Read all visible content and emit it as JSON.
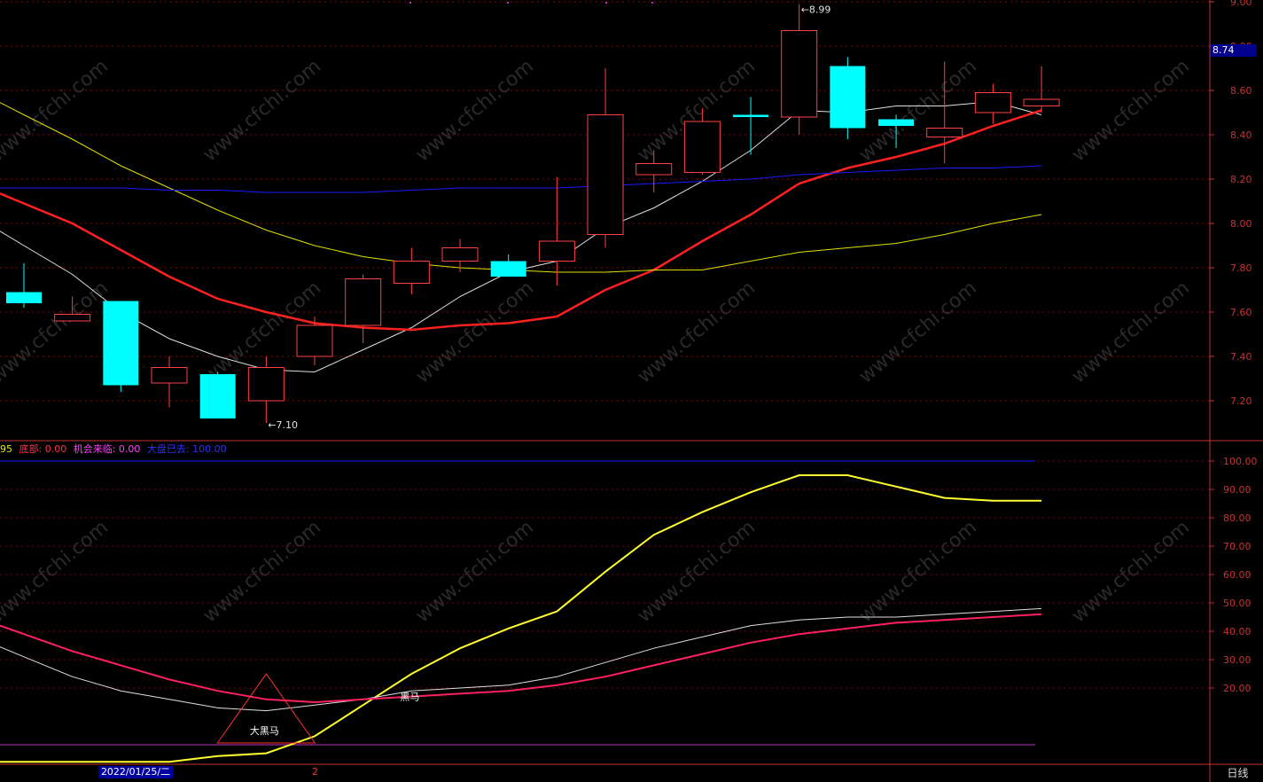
{
  "current_price_tag": "8.74",
  "period_label": "日线",
  "date_cursor": "2022/01/25/二",
  "date_cursor_2": "2",
  "indicator_header": [
    {
      "text": "95",
      "color": "#e6e600"
    },
    {
      "text": "底部: 0.00",
      "color": "#ff3050"
    },
    {
      "text": "机会来临: 0.00",
      "color": "#ff40ff"
    },
    {
      "text": "大盘已去: 100.00",
      "color": "#3030ff"
    }
  ],
  "watermark_text": "www.cfchi.com",
  "colors": {
    "up_candle": "#ff4040",
    "down_candle": "#00ffff",
    "ma_white": "#e0e0e0",
    "ma_red": "#ff2020",
    "ma_yellow": "#e0e000",
    "ma_blue": "#1a1aff",
    "grid": "#8b0000",
    "axis": "#c83232"
  },
  "chart_data": [
    {
      "type": "candlestick",
      "title": "",
      "ylim": [
        7.05,
        9.0
      ],
      "y_ticks": [
        "9.00",
        "8.80",
        "8.60",
        "8.40",
        "8.20",
        "8.00",
        "7.80",
        "7.60",
        "7.40",
        "7.20"
      ],
      "annotations": [
        {
          "text": "8.99",
          "candle_index": 16
        },
        {
          "text": "7.10",
          "candle_index": 5
        }
      ],
      "candles": [
        {
          "open": 7.64,
          "close": 7.69,
          "high": 7.82,
          "low": 7.62,
          "dir": "down"
        },
        {
          "open": 7.59,
          "close": 7.56,
          "high": 7.67,
          "low": 7.56,
          "dir": "up"
        },
        {
          "open": 7.65,
          "close": 7.27,
          "high": 7.65,
          "low": 7.24,
          "dir": "down"
        },
        {
          "open": 7.28,
          "close": 7.35,
          "high": 7.4,
          "low": 7.17,
          "dir": "up"
        },
        {
          "open": 7.32,
          "close": 7.12,
          "high": 7.33,
          "low": 7.12,
          "dir": "down"
        },
        {
          "open": 7.2,
          "close": 7.35,
          "high": 7.4,
          "low": 7.1,
          "dir": "up"
        },
        {
          "open": 7.4,
          "close": 7.54,
          "high": 7.58,
          "low": 7.36,
          "dir": "up"
        },
        {
          "open": 7.54,
          "close": 7.75,
          "high": 7.77,
          "low": 7.46,
          "dir": "up"
        },
        {
          "open": 7.73,
          "close": 7.83,
          "high": 7.89,
          "low": 7.68,
          "dir": "up"
        },
        {
          "open": 7.83,
          "close": 7.89,
          "high": 7.93,
          "low": 7.78,
          "dir": "up"
        },
        {
          "open": 7.83,
          "close": 7.76,
          "high": 7.86,
          "low": 7.76,
          "dir": "down"
        },
        {
          "open": 7.83,
          "close": 7.92,
          "high": 8.21,
          "low": 7.72,
          "dir": "up"
        },
        {
          "open": 7.95,
          "close": 8.49,
          "high": 8.7,
          "low": 7.89,
          "dir": "up"
        },
        {
          "open": 8.22,
          "close": 8.27,
          "high": 8.33,
          "low": 8.14,
          "dir": "up"
        },
        {
          "open": 8.23,
          "close": 8.46,
          "high": 8.52,
          "low": 8.22,
          "dir": "up"
        },
        {
          "open": 8.49,
          "close": 8.48,
          "high": 8.57,
          "low": 8.31,
          "dir": "down"
        },
        {
          "open": 8.48,
          "close": 8.87,
          "high": 8.99,
          "low": 8.4,
          "dir": "up"
        },
        {
          "open": 8.71,
          "close": 8.43,
          "high": 8.75,
          "low": 8.38,
          "dir": "down"
        },
        {
          "open": 8.47,
          "close": 8.44,
          "high": 8.49,
          "low": 8.34,
          "dir": "down"
        },
        {
          "open": 8.39,
          "close": 8.43,
          "high": 8.73,
          "low": 8.27,
          "dir": "up"
        },
        {
          "open": 8.5,
          "close": 8.59,
          "high": 8.63,
          "low": 8.45,
          "dir": "up"
        },
        {
          "open": 8.53,
          "close": 8.56,
          "high": 8.71,
          "low": 8.5,
          "dir": "up"
        }
      ],
      "series": [
        {
          "color": "#e0e0e0",
          "values": [
            7.9,
            7.77,
            7.6,
            7.48,
            7.4,
            7.34,
            7.33,
            7.43,
            7.53,
            7.67,
            7.78,
            7.83,
            7.98,
            8.07,
            8.19,
            8.33,
            8.51,
            8.5,
            8.53,
            8.53,
            8.55,
            8.49
          ]
        },
        {
          "color": "#ff2020",
          "values": [
            8.09,
            8.0,
            7.88,
            7.76,
            7.66,
            7.6,
            7.55,
            7.53,
            7.52,
            7.54,
            7.55,
            7.58,
            7.7,
            7.79,
            7.92,
            8.04,
            8.18,
            8.25,
            8.3,
            8.36,
            8.44,
            8.51
          ]
        },
        {
          "color": "#e0e000",
          "values": [
            8.49,
            8.38,
            8.26,
            8.16,
            8.06,
            7.97,
            7.9,
            7.85,
            7.82,
            7.8,
            7.79,
            7.78,
            7.78,
            7.79,
            7.79,
            7.83,
            7.87,
            7.89,
            7.91,
            7.95,
            8.0,
            8.04
          ]
        },
        {
          "color": "#1a1aff",
          "values": [
            8.16,
            8.16,
            8.16,
            8.15,
            8.15,
            8.14,
            8.14,
            8.14,
            8.15,
            8.16,
            8.16,
            8.16,
            8.17,
            8.18,
            8.19,
            8.2,
            8.22,
            8.23,
            8.24,
            8.25,
            8.25,
            8.26
          ]
        }
      ]
    },
    {
      "type": "line",
      "title": "",
      "ylim": [
        0,
        105
      ],
      "y_ticks": [
        "100.00",
        "90.00",
        "80.00",
        "70.00",
        "60.00",
        "50.00",
        "40.00",
        "30.00",
        "20.00"
      ],
      "reference_lines": [
        {
          "value": 100,
          "color": "#1a1aff"
        },
        {
          "value": 0,
          "color": "#c030c0"
        }
      ],
      "labels": [
        {
          "text": "大黑马",
          "x_index": 5,
          "y": 5
        },
        {
          "text": "黑马",
          "x_index": 8,
          "y": 17
        }
      ],
      "series": [
        {
          "color": "#ffff30",
          "values": [
            -6,
            -6,
            -6,
            -6,
            -4,
            -3,
            3,
            14,
            25,
            34,
            41,
            47,
            61,
            74,
            82,
            89,
            95,
            95,
            91,
            87,
            86,
            86
          ]
        },
        {
          "color": "#e0e0e0",
          "values": [
            31,
            24,
            19,
            16,
            13,
            12,
            14,
            16,
            19,
            20,
            21,
            24,
            29,
            34,
            38,
            42,
            44,
            45,
            45,
            46,
            47,
            48
          ]
        },
        {
          "color": "#ff2060",
          "values": [
            39,
            33,
            28,
            23,
            19,
            16,
            15,
            16,
            17,
            18,
            19,
            21,
            24,
            28,
            32,
            36,
            39,
            41,
            43,
            44,
            45,
            46
          ]
        }
      ]
    }
  ]
}
